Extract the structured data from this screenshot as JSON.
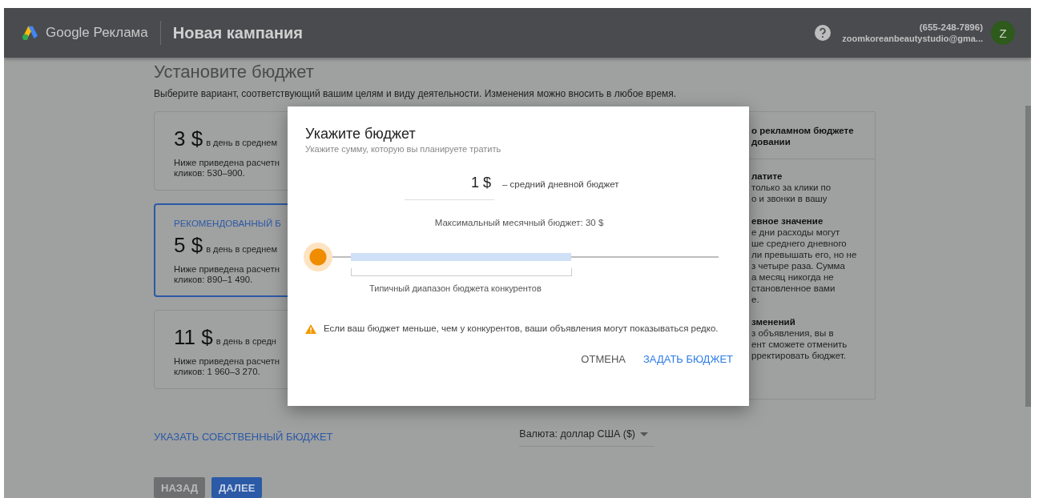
{
  "header": {
    "product": "Google Реклама",
    "title": "Новая кампания",
    "phone": "(655-248-7896)",
    "email": "zoomkoreanbeautystudio@gma...",
    "avatar": "Z"
  },
  "page": {
    "title": "Установите бюджет",
    "description": "Выберите вариант, соответствующий вашим целям и виду деятельности. Изменения можно вносить в любое время.",
    "cards": [
      {
        "amount": "3 $",
        "per": "в день в среднем",
        "lines": [
          "Ниже приведена расчетн",
          "кликов: 530–900."
        ],
        "selected": false
      },
      {
        "label": "РЕКОМЕНДОВАННЫЙ Б",
        "amount": "5 $",
        "per": "в день в среднем",
        "lines": [
          "Ниже приведена расчетн",
          "кликов: 890–1 490."
        ],
        "selected": true
      },
      {
        "amount": "11 $",
        "per": "в день в средн",
        "lines": [
          "Ниже приведена расчетн",
          "кликов: 1 960–3 270."
        ],
        "selected": false
      }
    ],
    "custom_link": "УКАЗАТЬ СОБСТВЕННЫЙ БЮДЖЕТ",
    "currency": "Валюта: доллар США ($)",
    "buttons": [
      {
        "label": "НАЗАД",
        "kind": "secondary"
      },
      {
        "label": "ДАЛЕЕ",
        "kind": "primary"
      }
    ]
  },
  "info_panel": {
    "heading": [
      "о рекламном бюджете",
      "довании"
    ],
    "sections": [
      {
        "title": "латите",
        "lines": [
          "только за клики по",
          "о и звонки в вашу"
        ]
      },
      {
        "title": "евное значение",
        "lines": [
          "е дни расходы могут",
          "ше среднего дневного",
          "ли превышать его, но не",
          "з четыре раза. Сумма",
          "а месяц никогда не",
          "становленное вами",
          "е."
        ]
      },
      {
        "title": "зменений",
        "lines": [
          "з объявления, вы в",
          "ент сможете отменить",
          "рректировать бюджет."
        ]
      }
    ]
  },
  "dialog": {
    "title": "Укажите бюджет",
    "subtitle": "Укажите сумму, которую вы планируете тратить",
    "amount": "1 $",
    "amount_label": "– средний дневной бюджет",
    "max_monthly": "Максимальный месячный бюджет: 30 $",
    "slider": {
      "level": 0
    },
    "range_label": "Типичный диапазон бюджета конкурентов",
    "warning": "Если ваш бюджет меньше, чем у конкурентов, ваши объявления могут показываться редко.",
    "buttons": [
      {
        "label": "ОТМЕНА",
        "kind": "text"
      },
      {
        "label": "ЗАДАТЬ БЮДЖЕТ",
        "kind": "primary"
      }
    ]
  }
}
